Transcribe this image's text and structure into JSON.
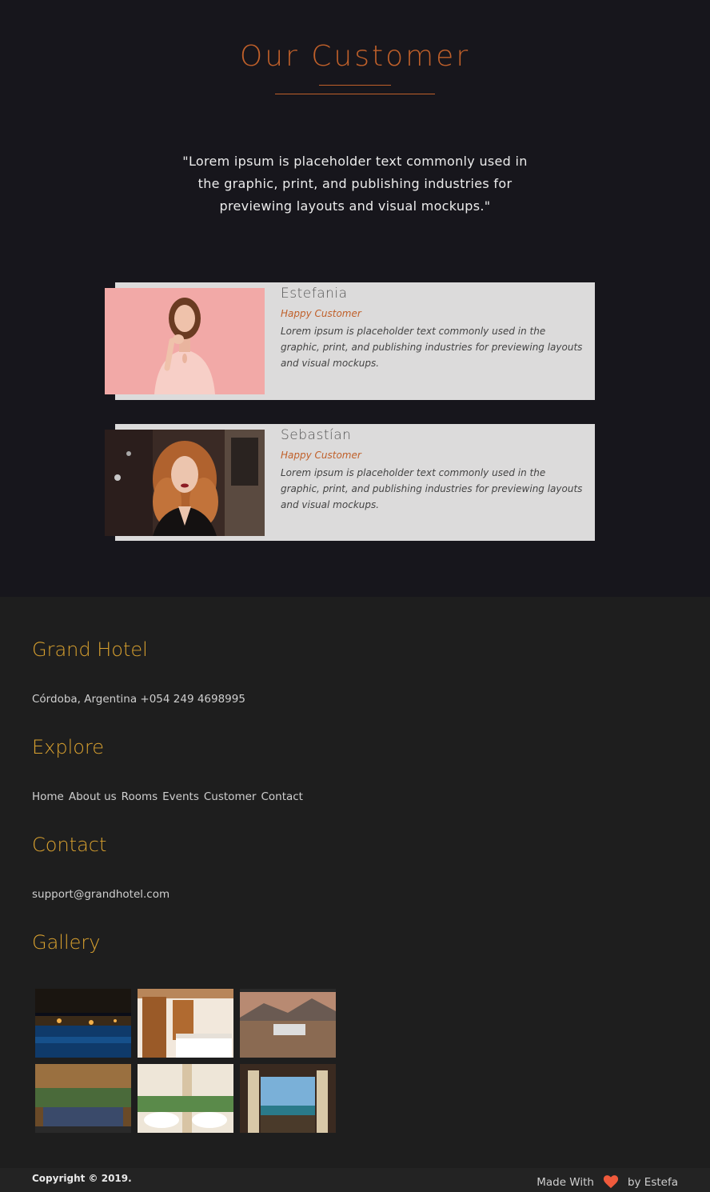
{
  "customers": {
    "title": "Our Customer",
    "quote": "\"Lorem ipsum is placeholder text commonly used in the graphic, print, and publishing industries for previewing layouts and visual mockups.\"",
    "accent_color": "#c0602a",
    "cards": [
      {
        "name": "Estefania",
        "role": "Happy Customer",
        "text": "Lorem ipsum is placeholder text commonly used in the graphic, print, and publishing industries for previewing layouts and visual mockups.",
        "photo_icon": "woman-pink-background-photo"
      },
      {
        "name": "Sebastían",
        "role": "Happy Customer",
        "text": "Lorem ipsum is placeholder text commonly used in the graphic, print, and publishing industries for previewing layouts and visual mockups.",
        "photo_icon": "woman-red-hair-photo"
      }
    ]
  },
  "footer": {
    "heading_color": "#d9a12f",
    "hotel": {
      "title": "Grand Hotel",
      "address": "Córdoba, Argentina +054 249 4698995"
    },
    "explore": {
      "title": "Explore",
      "links": [
        "Home",
        "About us",
        "Rooms",
        "Events",
        "Customer",
        "Contact"
      ]
    },
    "contact": {
      "title": "Contact",
      "email": "support@grandhotel.com"
    },
    "gallery": {
      "title": "Gallery",
      "images": [
        "pool-at-night",
        "hotel-bedroom",
        "mountain-view-room",
        "lobby-lounge",
        "banquet-hall",
        "terrace-lounge"
      ]
    },
    "copyright": "Copyright © 2019.",
    "made_with": "Made With",
    "author": "by Estefa",
    "heart_color": "#f05a3c"
  }
}
